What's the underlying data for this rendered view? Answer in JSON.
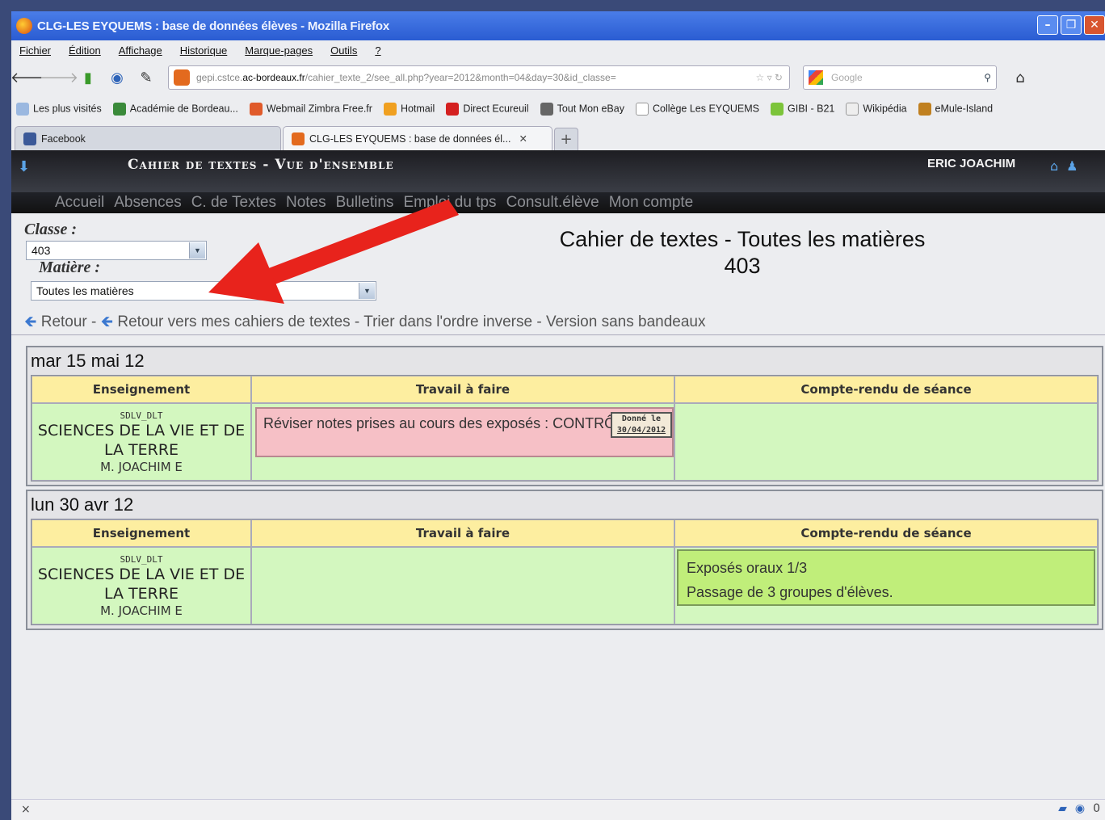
{
  "browser": {
    "window_title": "CLG-LES EYQUEMS : base de données élèves - Mozilla Firefox",
    "menu": [
      "Fichier",
      "Édition",
      "Affichage",
      "Historique",
      "Marque-pages",
      "Outils",
      "?"
    ],
    "url_prefix": "gepi.cstce.",
    "url_domain": "ac-bordeaux.fr",
    "url_rest": "/cahier_texte_2/see_all.php?year=2012&month=04&day=30&id_classe=",
    "search_placeholder": "Google",
    "bookmarks": [
      "Les plus visités",
      "Académie de Bordeau...",
      "Webmail Zimbra Free.fr",
      "Hotmail",
      "Direct Ecureuil",
      "Tout Mon eBay",
      "Collège Les EYQUEMS",
      "GIBI - B21",
      "Wikipédia",
      "eMule-Island"
    ],
    "tabs": [
      "Facebook",
      "CLG-LES EYQUEMS : base de données él..."
    ],
    "new_tab": "+"
  },
  "app": {
    "title": "Cahier de textes - Vue d'ensemble",
    "user": "ERIC JOACHIM",
    "nav": [
      "Accueil",
      "Absences",
      "C. de Textes",
      "Notes",
      "Bulletins",
      "Emploi du tps",
      "Consult.élève",
      "Mon compte"
    ]
  },
  "filters": {
    "classe_label": "Classe :",
    "classe_value": "403",
    "matiere_label": "Matière :",
    "matiere_value": "Toutes les matières"
  },
  "page": {
    "title_line1": "Cahier de textes - Toutes les matières",
    "title_line2": "403",
    "links": [
      "Retour",
      "Retour vers mes cahiers de textes",
      "Trier dans l'ordre inverse",
      "Version sans bandeaux"
    ],
    "sep": " - "
  },
  "columns": [
    "Enseignement",
    "Travail à faire",
    "Compte-rendu de séance"
  ],
  "days": [
    {
      "date": "mar 15 mai 12",
      "code": "SDLV_DLT",
      "subject": "SCIENCES DE LA VIE ET DE LA TERRE",
      "teacher": "M. JOACHIM E",
      "travail": "Réviser notes prises au cours des exposés : CONTRÔLE",
      "donne_label": "Donné le",
      "donne_date": "30/04/2012",
      "compte_rendu_1": "",
      "compte_rendu_2": ""
    },
    {
      "date": "lun 30 avr 12",
      "code": "SDLV_DLT",
      "subject": "SCIENCES DE LA VIE ET DE LA TERRE",
      "teacher": "M. JOACHIM E",
      "travail": "",
      "compte_rendu_1": "Exposés oraux 1/3",
      "compte_rendu_2": "Passage de 3 groupes d'élèves."
    }
  ],
  "status": {
    "close": "×",
    "count": "0"
  },
  "colors": {
    "header_yellow": "#fdeea0",
    "cell_green": "#d3f7bf",
    "travail_pink": "#f6c0c6",
    "compte_rendu_green": "#c0ee7a",
    "annotation_arrow": "#e8231c"
  }
}
